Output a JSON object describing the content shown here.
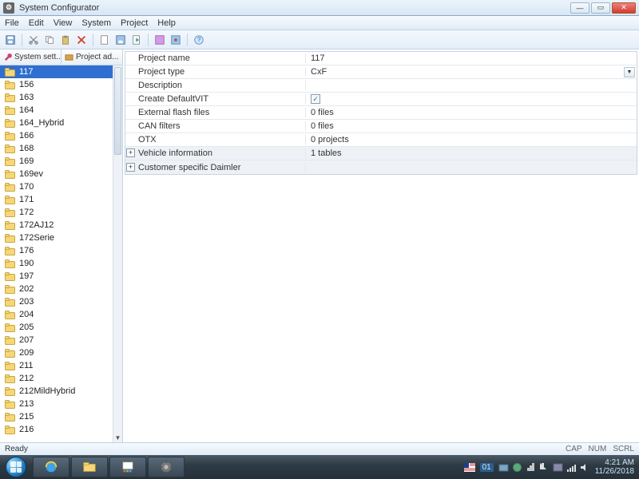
{
  "window": {
    "title": "System Configurator"
  },
  "menus": {
    "file": "File",
    "edit": "Edit",
    "view": "View",
    "system": "System",
    "project": "Project",
    "help": "Help"
  },
  "tabs": {
    "left1": "System sett...",
    "left2": "Project ad..."
  },
  "tree_items": [
    {
      "label": "117",
      "selected": true
    },
    {
      "label": "156"
    },
    {
      "label": "163"
    },
    {
      "label": "164"
    },
    {
      "label": "164_Hybrid"
    },
    {
      "label": "166"
    },
    {
      "label": "168"
    },
    {
      "label": "169"
    },
    {
      "label": "169ev"
    },
    {
      "label": "170"
    },
    {
      "label": "171"
    },
    {
      "label": "172"
    },
    {
      "label": "172AJ12"
    },
    {
      "label": "172Serie"
    },
    {
      "label": "176"
    },
    {
      "label": "190"
    },
    {
      "label": "197"
    },
    {
      "label": "202"
    },
    {
      "label": "203"
    },
    {
      "label": "204"
    },
    {
      "label": "205"
    },
    {
      "label": "207"
    },
    {
      "label": "209"
    },
    {
      "label": "211"
    },
    {
      "label": "212"
    },
    {
      "label": "212MildHybrid"
    },
    {
      "label": "213"
    },
    {
      "label": "215"
    },
    {
      "label": "216"
    }
  ],
  "props": {
    "project_name": {
      "k": "Project name",
      "v": "117"
    },
    "project_type": {
      "k": "Project type",
      "v": "CxF"
    },
    "description": {
      "k": "Description",
      "v": ""
    },
    "create_default_vit": {
      "k": "Create DefaultVIT",
      "v": "checked"
    },
    "external_flash": {
      "k": "External flash files",
      "v": "0 files"
    },
    "can_filters": {
      "k": "CAN filters",
      "v": "0 files"
    },
    "otx": {
      "k": "OTX",
      "v": "0 projects"
    },
    "vehicle_info": {
      "k": "Vehicle information",
      "v": "1 tables"
    },
    "customer": {
      "k": "Customer specific Daimler",
      "v": ""
    }
  },
  "status": {
    "ready": "Ready",
    "cap": "CAP",
    "num": "NUM",
    "scrl": "SCRL"
  },
  "tray": {
    "time": "4:21 AM",
    "date": "11/26/2018",
    "lang_num": "01"
  }
}
